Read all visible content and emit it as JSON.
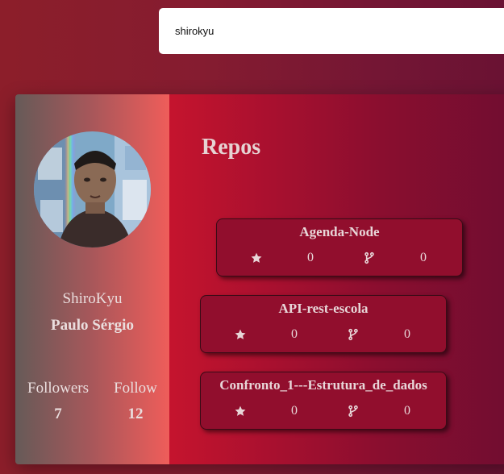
{
  "search": {
    "value": "shirokyu"
  },
  "profile": {
    "username": "ShiroKyu",
    "name": "Paulo Sérgio",
    "followers_label": "Followers",
    "followers_count": "7",
    "follow_label": "Follow",
    "follow_count": "12"
  },
  "repos": {
    "title": "Repos",
    "items": [
      {
        "name": "Agenda-Node",
        "stars": "0",
        "forks": "0"
      },
      {
        "name": "API-rest-escola",
        "stars": "0",
        "forks": "0"
      },
      {
        "name": "Confronto_1---Estrutura_de_dados",
        "stars": "0",
        "forks": "0"
      }
    ]
  },
  "icons": {
    "star": "star-icon",
    "fork": "git-fork-icon"
  },
  "colors": {
    "background": "#851c30",
    "profile_panel_start": "#665a58",
    "profile_panel_end": "#ef5d5a",
    "repos_panel_start": "#c5142e",
    "repos_panel_end": "#700d30",
    "repo_card": "#910e2d",
    "text": "#e8d6d8"
  }
}
